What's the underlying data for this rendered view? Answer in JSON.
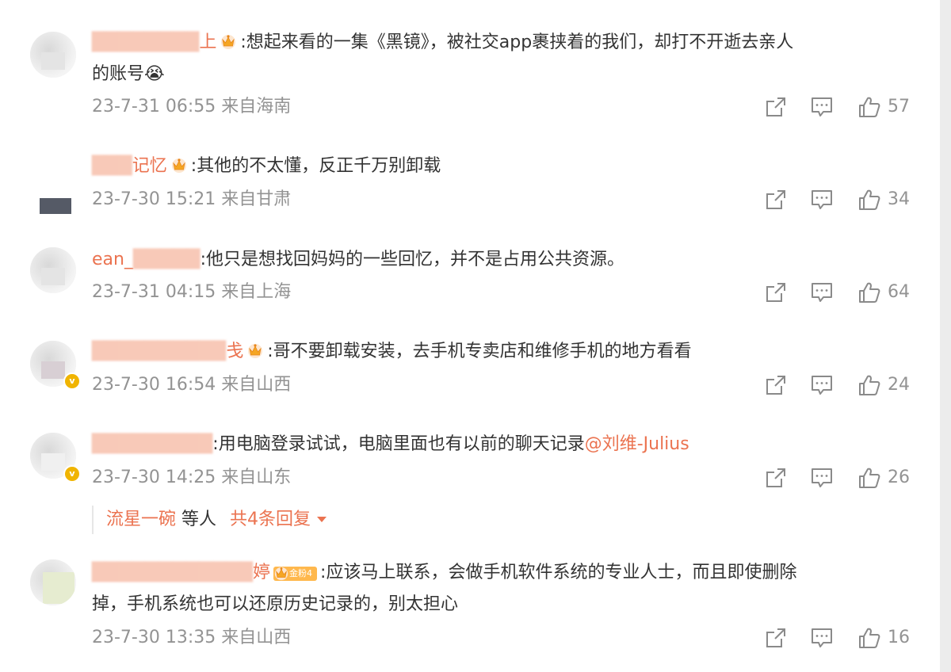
{
  "comments": [
    {
      "user": "上",
      "text": ":想起来看的一集《黑镜》，被社交app裹挟着的我们，却打不开逝去亲人",
      "text2": "的账号",
      "emoji": "😭",
      "time": "23-7-31 06:55",
      "location": "来自海南",
      "likes": "57"
    },
    {
      "user": "记忆",
      "text": ":其他的不太懂，反正千万别卸载",
      "time": "23-7-30 15:21",
      "location": "来自甘肃",
      "likes": "34"
    },
    {
      "user": "ean_",
      "text": ":他只是想找回妈妈的一些回忆，并不是占用公共资源。",
      "time": "23-7-31 04:15",
      "location": "来自上海",
      "likes": "64"
    },
    {
      "user": "戋",
      "text": ":哥不要卸载安装，去手机专卖店和维修手机的地方看看",
      "time": "23-7-30 16:54",
      "location": "来自山西",
      "likes": "24"
    },
    {
      "user": "",
      "text": ":用电脑登录试试，电脑里面也有以前的聊天记录",
      "mention": "@刘维-Julius",
      "time": "23-7-30 14:25",
      "location": "来自山东",
      "likes": "26"
    },
    {
      "user": "婷",
      "badge": "金粉4",
      "text": ":应该马上联系，会做手机软件系统的专业人士，而且即使删除",
      "text2": "掉，手机系统也可以还原历史记录的，别太担心",
      "time": "23-7-30 13:35",
      "location": "来自山西",
      "likes": "16"
    }
  ],
  "reply": {
    "user": "流星一碗",
    "etc": "等人",
    "total": "共4条回复"
  },
  "colors": {
    "accent": "#eb7350",
    "meta": "#939393",
    "text": "#333333"
  },
  "icons": {
    "share": "share-icon",
    "comment": "comment-icon",
    "like": "thumbs-up-icon",
    "crown": "crown-icon"
  }
}
